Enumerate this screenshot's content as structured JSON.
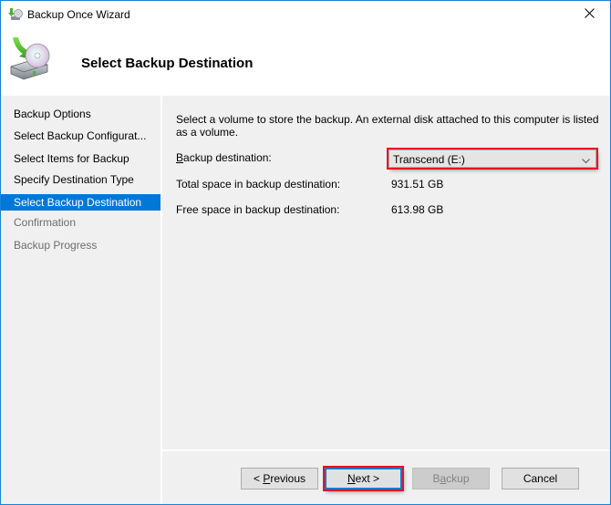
{
  "window": {
    "title": "Backup Once Wizard",
    "icon": "backup-wizard-icon",
    "close_icon": "close-icon"
  },
  "header": {
    "title": "Select Backup Destination",
    "icon": "backup-drive-disc-icon"
  },
  "sidebar": {
    "items": [
      {
        "label": "Backup Options",
        "state": "completed"
      },
      {
        "label": "Select Backup Configurat...",
        "state": "completed"
      },
      {
        "label": "Select Items for Backup",
        "state": "completed"
      },
      {
        "label": "Specify Destination Type",
        "state": "completed"
      },
      {
        "label": "Select Backup Destination",
        "state": "selected"
      },
      {
        "label": "Confirmation",
        "state": "disabled"
      },
      {
        "label": "Backup Progress",
        "state": "disabled"
      }
    ]
  },
  "main": {
    "description": "Select a volume to store the backup. An external disk attached to this computer is listed as a volume.",
    "destination": {
      "label_accel": "B",
      "label_rest": "ackup destination:",
      "selected_value": "Transcend (E:)",
      "dropdown_icon": "chevron-down-icon",
      "highlight_color": "#e81123"
    },
    "total_space": {
      "label": "Total space in backup destination:",
      "value": "931.51 GB"
    },
    "free_space": {
      "label": "Free space in backup destination:",
      "value": "613.98 GB"
    }
  },
  "footer": {
    "previous": {
      "prefix": "< ",
      "accel": "P",
      "rest": "revious"
    },
    "next": {
      "accel": "N",
      "rest": "ext >"
    },
    "backup": {
      "pre": "B",
      "accel": "a",
      "rest": "ckup"
    },
    "cancel": {
      "label": "Cancel"
    }
  },
  "colors": {
    "accent": "#0078d7",
    "window_border": "#1883d7",
    "highlight_box": "#e81123",
    "panel_bg": "#f0f0f0",
    "disabled_text": "#6d6d6d"
  }
}
